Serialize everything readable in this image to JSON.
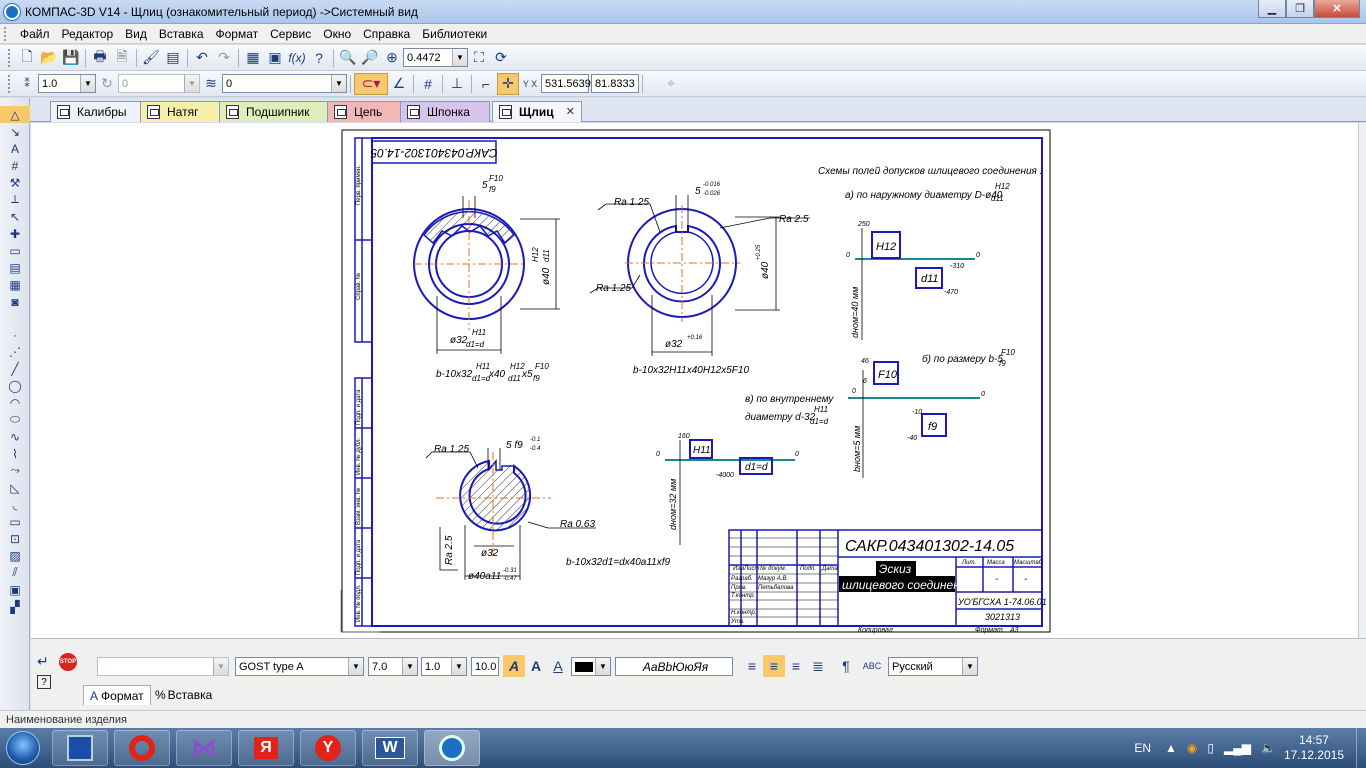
{
  "window": {
    "title": "КОМПАС-3D V14 - Щлиц (ознакомительный период) ->Системный вид",
    "min": "▁",
    "max": "❐",
    "close": "✕"
  },
  "menu": [
    "Файл",
    "Редактор",
    "Вид",
    "Вставка",
    "Формат",
    "Сервис",
    "Окно",
    "Справка",
    "Библиотеки"
  ],
  "toolbar1": {
    "zoom": "0.4472"
  },
  "toolbar2": {
    "step": "1.0",
    "angle": "0",
    "layer": "0",
    "coord_x": "531.5639",
    "coord_y": "81.8333"
  },
  "tabs": [
    {
      "label": "Калибры",
      "color": "#eef2fa"
    },
    {
      "label": "Натяг",
      "color": "#f7eeaa"
    },
    {
      "label": "Подшипник",
      "color": "#dfeebb"
    },
    {
      "label": "Цепь",
      "color": "#f3b7b7"
    },
    {
      "label": "Шпонка",
      "color": "#d8c3ea"
    },
    {
      "label": "Щлиц",
      "color": "#f4f6fa"
    }
  ],
  "drawing": {
    "frame_code": "САКР.043401302-14.05",
    "title_code": "САКР.043401302-14.05",
    "heading1": "Схемы полей допусков шлицевого соединения :",
    "heading_a": "а) по наружному диаметру D-ø40",
    "heading_a_frac": [
      "H12",
      "d11"
    ],
    "heading_b": "б) по размеру b-5",
    "heading_b_frac": [
      "F10",
      "f9"
    ],
    "heading_v1": "в) по внутреннему",
    "heading_v2": "диаметру d-32",
    "heading_v_frac": [
      "H11",
      "d1=d"
    ],
    "d1": {
      "b": "5",
      "b_frac": [
        "F10",
        "f9"
      ],
      "dia": "ø40",
      "dia_frac": [
        "H12",
        "d11"
      ],
      "bore": "ø32",
      "bore_frac": [
        "H11",
        "d1=d"
      ],
      "label": "b-10x32",
      "label_frac1": [
        "H11",
        "d1=d"
      ],
      "label_mid": "x40",
      "label_frac2": [
        "H12",
        "d11"
      ],
      "label_end": "x5",
      "label_frac3": [
        "F10",
        "f9"
      ]
    },
    "d2": {
      "ra1": "Ra 1.25",
      "ra2": "Ra 2.5",
      "ra3": "Ra 1.25",
      "b": "5",
      "b_dev": [
        "-0.016",
        "-0.026"
      ],
      "dia": "ø40",
      "dia_dev": "+0.25",
      "bore": "ø32",
      "bore_dev": "+0.16",
      "label": "b-10x32H11x40H12x5F10"
    },
    "d3": {
      "ra1": "Ra 1.25",
      "ra2": "Ra 0.63",
      "ra3": "Ra 2.5",
      "b": "5 f9",
      "b_dev": [
        "-0.1",
        "-0.4"
      ],
      "bore": "ø32",
      "dia": "ø40a11",
      "dia_dev": [
        "-0.31",
        "-0.47"
      ],
      "label": "b-10x32d1=dx40a11xf9"
    },
    "schemeA": {
      "H": "H12",
      "d": "d11",
      "v1": "250",
      "z": "0",
      "v2": "-310",
      "v3": "-470",
      "ax": "dнoм=40 мм"
    },
    "schemeB": {
      "H": "F10",
      "d": "f9",
      "v1": "46",
      "v2": "6",
      "z": "0",
      "v3": "-10",
      "v4": "-40",
      "ax": "bнoм=5 мм"
    },
    "schemeV": {
      "H": "H11",
      "d": "d1=d",
      "v1": "160",
      "z": "0",
      "v2": "-4000",
      "ax": "dнoм=32 мм"
    },
    "stamp": {
      "title1": "Эскиз",
      "title2": "шлицевого соединения",
      "org": "УО'БГСХА 1-74.06.01",
      "group": "3021313",
      "razrab": "Разраб.",
      "razrab_name": "Мазур А.В.",
      "prov": "Пров.",
      "prov_name": "Петьбалова",
      "tkontr": "Т.контр.",
      "nkontr": "Н.контр.",
      "utv": "Утв.",
      "izm": "Изм",
      "list": "Лист",
      "ndok": "№ докум.",
      "podp": "Подп.",
      "data": "Дата",
      "lit": "Лит.",
      "massa": "Масса",
      "masshtab": "Масштаб",
      "dash": "-",
      "kopiroval": "Копировал",
      "format": "Формат",
      "a3": "А3"
    },
    "margin_labels": [
      "Перв. примен.",
      "Справ. №",
      "Подп. и дата",
      "Инв. № дубл.",
      "Взам. инв. №",
      "Подп. и дата",
      "Инв. № подл."
    ]
  },
  "properties": {
    "style": "GOST type A",
    "height": "7.0",
    "width": "1.0",
    "scale": "10.0",
    "sample": "АаВbЮюЯя",
    "lang": "Русский",
    "tab_format": "Формат",
    "tab_insert": "Вставка"
  },
  "status": {
    "text": "Наименование изделия"
  },
  "tray": {
    "lang": "EN",
    "time": "14:57",
    "date": "17.12.2015"
  }
}
